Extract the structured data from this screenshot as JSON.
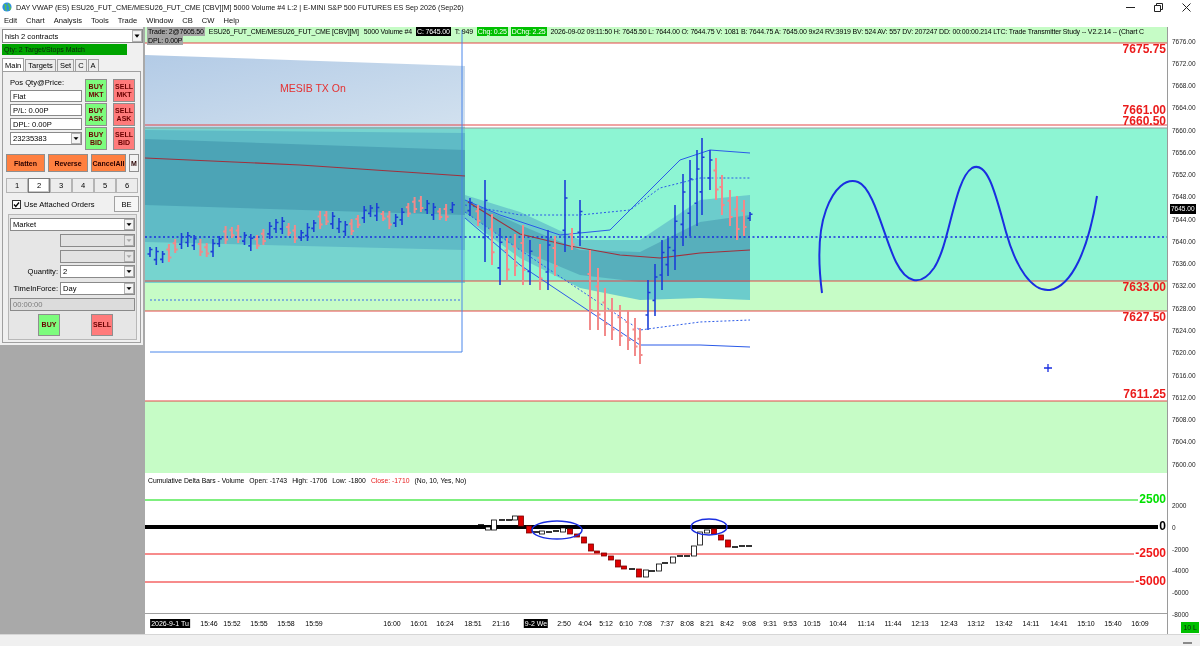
{
  "window": {
    "title": "DAY VWAP (ES) ESU26_FUT_CME/MESU26_FUT_CME [CBV][M] 5000 Volume #4 L:2 | E-MINI S&P 500 FUTURES ES Sep 2026 (Sep26)"
  },
  "menu": [
    "Edit",
    "Chart",
    "Analysis",
    "Tools",
    "Trade",
    "Window",
    "CB",
    "CW",
    "Help"
  ],
  "trade_panel": {
    "preset": "hish 2 contracts",
    "status": "Qty: 2 Target/Stops Match",
    "tabs": [
      {
        "label": "Main",
        "selected": true
      },
      {
        "label": "Targets",
        "selected": false
      },
      {
        "label": "Set",
        "selected": false
      },
      {
        "label": "C",
        "selected": false
      },
      {
        "label": "A",
        "selected": false
      }
    ],
    "position_label": "Pos Qty@Price:",
    "position_fields": [
      "Flat",
      "P/L: 0.00P",
      "DPL: 0.00P"
    ],
    "account": "23235383",
    "order_buttons": [
      {
        "label": "BUY MKT",
        "kind": "buy"
      },
      {
        "label": "SELL MKT",
        "kind": "sell"
      },
      {
        "label": "BUY ASK",
        "kind": "buy"
      },
      {
        "label": "SELL ASK",
        "kind": "sell"
      },
      {
        "label": "BUY BID",
        "kind": "buy"
      },
      {
        "label": "SELL BID",
        "kind": "sell"
      }
    ],
    "action_buttons": [
      {
        "label": "Flatten",
        "kind": "action"
      },
      {
        "label": "Reverse",
        "kind": "action"
      },
      {
        "label": "CancelAll",
        "kind": "action"
      },
      {
        "label": "M",
        "kind": "plain"
      }
    ],
    "quantity_presets": [
      {
        "label": "1",
        "selected": false
      },
      {
        "label": "2",
        "selected": true
      },
      {
        "label": "3",
        "selected": false
      },
      {
        "label": "4",
        "selected": false
      },
      {
        "label": "5",
        "selected": false
      },
      {
        "label": "6",
        "selected": false
      }
    ],
    "attached_orders": {
      "label": "Use Attached Orders",
      "checked": true
    },
    "breakeven_button": "BE",
    "order_type": "Market",
    "secondary_selects": [
      {
        "disabled": true
      },
      {
        "disabled": true
      }
    ],
    "quantity": {
      "label": "Quantity:",
      "value": "2"
    },
    "time_in_force": {
      "label": "TimeInForce:",
      "value": "Day"
    },
    "expiry": {
      "value": "00:00:00",
      "disabled": true
    },
    "submit_buttons": [
      {
        "label": "BUY",
        "kind": "buy"
      },
      {
        "label": "SELL",
        "kind": "sell"
      }
    ]
  },
  "price_chart": {
    "header": [
      {
        "text": "Trade: 2@7605.50",
        "kind": "highlight"
      },
      {
        "text": "ESU26_FUT_CME/MESU26_FUT_CME [CBV][M]",
        "kind": "plain"
      },
      {
        "text": "5000 Volume #4",
        "kind": "plain"
      },
      {
        "text": "C: 7645.00",
        "kind": "inverse"
      },
      {
        "text": "T: 949",
        "kind": "plain"
      },
      {
        "text": "Chg: 0.25",
        "kind": "positive"
      },
      {
        "text": "DChg: 2.25",
        "kind": "positive"
      },
      {
        "text": "2026-09-02 09:11:50 H: 7645.50 L: 7644.00 O: 7644.75 V: 1081 B: 7644.75 A: 7645.00 9x24 RV:3919 BV: 524 AV: 557 DV: 207247 DD: 00:00:00.214 LTC: Trade Transmitter Study -- V2.2.14 -- (Chart C",
        "kind": "plain"
      }
    ],
    "header_second_line": [
      {
        "text": "DPL: 0.00P",
        "kind": "highlight"
      }
    ],
    "annotation": "MESIB TX On",
    "levels": [
      "7675.75",
      "7661.00",
      "7660.50",
      "7633.00",
      "7627.50",
      "7611.25"
    ],
    "y_ticks": [
      "7676.00",
      "7672.00",
      "7668.00",
      "7664.00",
      "7660.00",
      "7656.00",
      "7652.00",
      "7648.00",
      "7644.00",
      "7640.00",
      "7636.00",
      "7632.00",
      "7628.00",
      "7624.00",
      "7620.00",
      "7616.00",
      "7612.00",
      "7608.00",
      "7604.00",
      "7600.00"
    ],
    "last_price": "7645.00"
  },
  "delta_chart": {
    "title": "Cumulative Delta Bars - Volume",
    "values": [
      {
        "text": "Open: -1743",
        "kind": "plain"
      },
      {
        "text": "High: -1706",
        "kind": "plain"
      },
      {
        "text": "Low: -1800",
        "kind": "plain"
      },
      {
        "text": "Close: -1710",
        "kind": "alert"
      }
    ],
    "parameters": "(No, 10, Yes, No)",
    "levels": [
      {
        "label": "2500",
        "kind": "positive"
      },
      {
        "label": "0",
        "kind": "zero"
      },
      {
        "label": "-2500",
        "kind": "negative"
      },
      {
        "label": "-5000",
        "kind": "negative"
      }
    ],
    "y_ticks": [
      "2000",
      "0",
      "-2000",
      "-4000",
      "-6000",
      "-8000"
    ]
  },
  "time_axis": [
    {
      "label": "2026-9-1 Tu",
      "kind": "date"
    },
    {
      "label": "15:46",
      "kind": "time"
    },
    {
      "label": "15:52",
      "kind": "time"
    },
    {
      "label": "15:55",
      "kind": "time"
    },
    {
      "label": "15:58",
      "kind": "time"
    },
    {
      "label": "15:59",
      "kind": "time"
    },
    {
      "label": "16:00",
      "kind": "time"
    },
    {
      "label": "16:01",
      "kind": "time"
    },
    {
      "label": "16:24",
      "kind": "time"
    },
    {
      "label": "18:51",
      "kind": "time"
    },
    {
      "label": "21:16",
      "kind": "time"
    },
    {
      "label": "9-2 We",
      "kind": "date"
    },
    {
      "label": "2:50",
      "kind": "time"
    },
    {
      "label": "4:04",
      "kind": "time"
    },
    {
      "label": "5:12",
      "kind": "time"
    },
    {
      "label": "6:10",
      "kind": "time"
    },
    {
      "label": "7:08",
      "kind": "time"
    },
    {
      "label": "7:37",
      "kind": "time"
    },
    {
      "label": "8:08",
      "kind": "time"
    },
    {
      "label": "8:21",
      "kind": "time"
    },
    {
      "label": "8:42",
      "kind": "time"
    },
    {
      "label": "9:08",
      "kind": "time"
    },
    {
      "label": "9:31",
      "kind": "time"
    },
    {
      "label": "9:53",
      "kind": "time"
    },
    {
      "label": "10:15",
      "kind": "time"
    },
    {
      "label": "10:44",
      "kind": "time"
    },
    {
      "label": "11:14",
      "kind": "time"
    },
    {
      "label": "11:44",
      "kind": "time"
    },
    {
      "label": "12:13",
      "kind": "time"
    },
    {
      "label": "12:43",
      "kind": "time"
    },
    {
      "label": "13:12",
      "kind": "time"
    },
    {
      "label": "13:42",
      "kind": "time"
    },
    {
      "label": "14:11",
      "kind": "time"
    },
    {
      "label": "14:41",
      "kind": "time"
    },
    {
      "label": "15:10",
      "kind": "time"
    },
    {
      "label": "15:40",
      "kind": "time"
    },
    {
      "label": "16:09",
      "kind": "time"
    }
  ],
  "status_badge": "10 L"
}
